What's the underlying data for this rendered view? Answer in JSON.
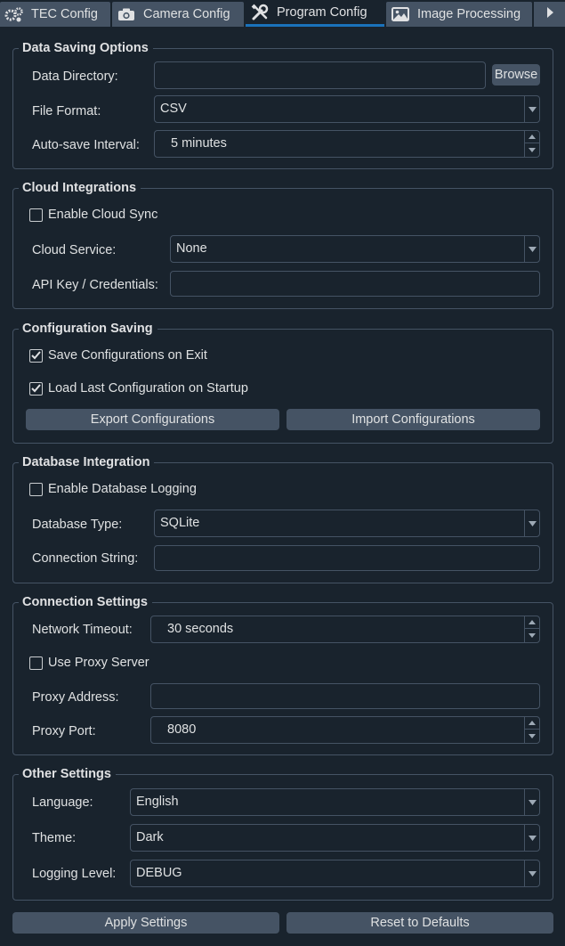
{
  "tabs": [
    {
      "label": "TEC Config",
      "icon": "gears-icon",
      "active": false
    },
    {
      "label": "Camera Config",
      "icon": "camera-icon",
      "active": false
    },
    {
      "label": "Program Config",
      "icon": "tools-icon",
      "active": true
    },
    {
      "label": "Image Processing",
      "icon": "image-icon",
      "active": false
    }
  ],
  "data_saving": {
    "title": "Data Saving Options",
    "dir_label": "Data Directory:",
    "dir_value": "",
    "browse": "Browse",
    "format_label": "File Format:",
    "format_value": "CSV",
    "autosave_label": "Auto-save Interval:",
    "autosave_value": "5 minutes"
  },
  "cloud": {
    "title": "Cloud Integrations",
    "sync_label": "Enable Cloud Sync",
    "sync_checked": false,
    "service_label": "Cloud Service:",
    "service_value": "None",
    "apikey_label": "API Key / Credentials:",
    "apikey_value": ""
  },
  "config_saving": {
    "title": "Configuration Saving",
    "save_exit_label": "Save Configurations on Exit",
    "save_exit_checked": true,
    "load_last_label": "Load Last Configuration on Startup",
    "load_last_checked": true,
    "export": "Export Configurations",
    "import": "Import Configurations"
  },
  "database": {
    "title": "Database Integration",
    "logging_label": "Enable Database Logging",
    "logging_checked": false,
    "type_label": "Database Type:",
    "type_value": "SQLite",
    "conn_label": "Connection String:",
    "conn_value": ""
  },
  "connection": {
    "title": "Connection Settings",
    "timeout_label": "Network Timeout:",
    "timeout_value": "30 seconds",
    "proxy_label": "Use Proxy Server",
    "proxy_checked": false,
    "proxy_addr_label": "Proxy Address:",
    "proxy_addr_value": "",
    "proxy_port_label": "Proxy Port:",
    "proxy_port_value": "8080"
  },
  "other": {
    "title": "Other Settings",
    "language_label": "Language:",
    "language_value": "English",
    "theme_label": "Theme:",
    "theme_value": "Dark",
    "logging_label": "Logging Level:",
    "logging_value": "DEBUG"
  },
  "footer": {
    "apply": "Apply Settings",
    "reset": "Reset to Defaults"
  },
  "colors": {
    "background": "#19232d",
    "control": "#455364",
    "accent": "#1a72bb",
    "text": "#dfe1e2"
  }
}
